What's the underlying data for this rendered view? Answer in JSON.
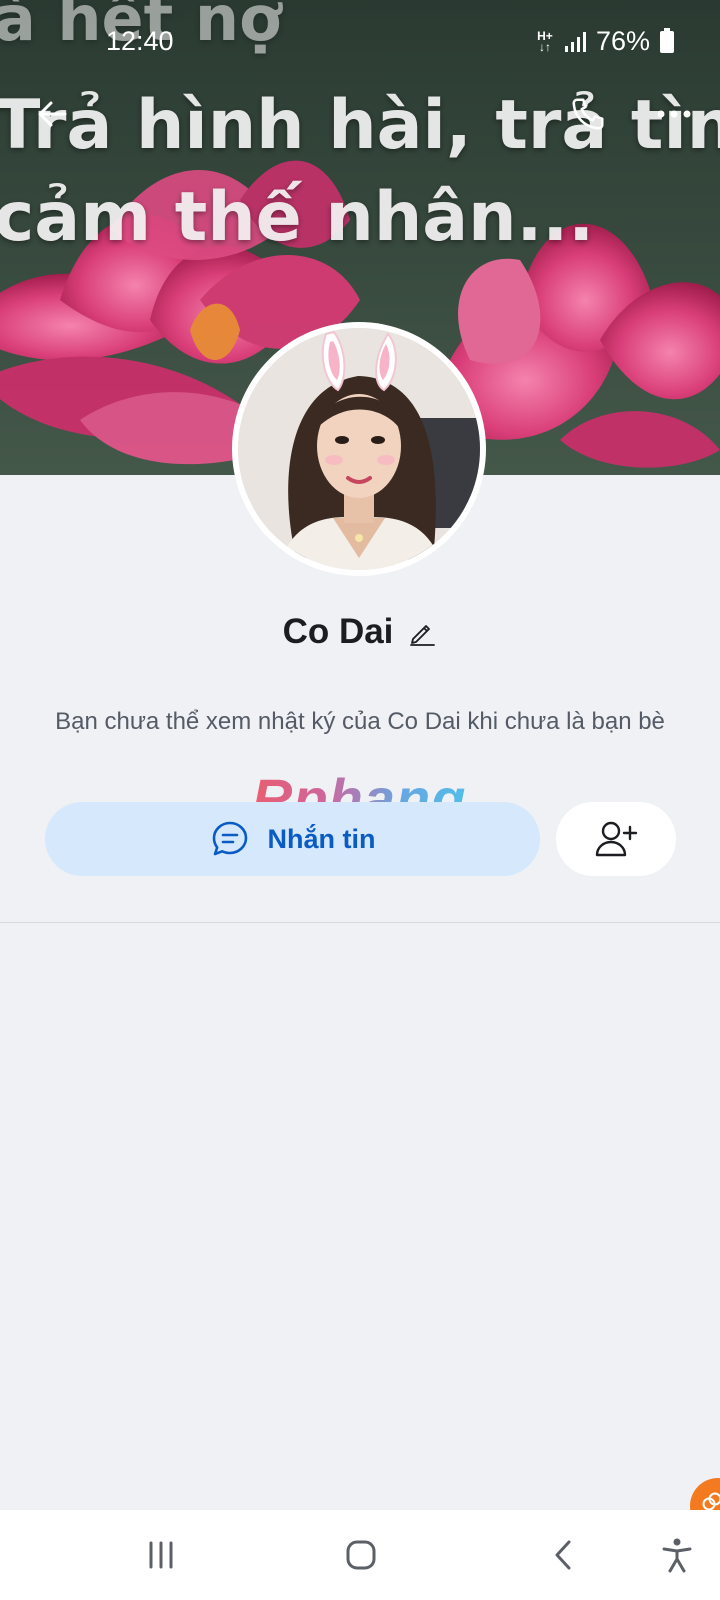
{
  "status_bar": {
    "time": "12:40",
    "network": "H+",
    "battery": "76%"
  },
  "cover": {
    "lines": [
      "à hết nợ",
      "Trả hình hài, trả tình",
      "cảm thế nhân..."
    ]
  },
  "profile": {
    "name": "Co Dai",
    "notice": "Bạn chưa thể xem nhật ký của Co Dai khi chưa là bạn bè"
  },
  "actions": {
    "message_label": "Nhắn tin"
  },
  "watermark": "Rphang",
  "colors": {
    "accent": "#0a5cc5",
    "message_button_bg": "#d6e8fc",
    "page_bg": "#eff1f5",
    "bubble": "#f47a20"
  },
  "icons": {
    "back": "arrow-left-icon",
    "call": "phone-icon",
    "more": "more-icon",
    "edit": "pencil-icon",
    "message": "chat-bubble-icon",
    "add_friend": "add-user-icon"
  }
}
